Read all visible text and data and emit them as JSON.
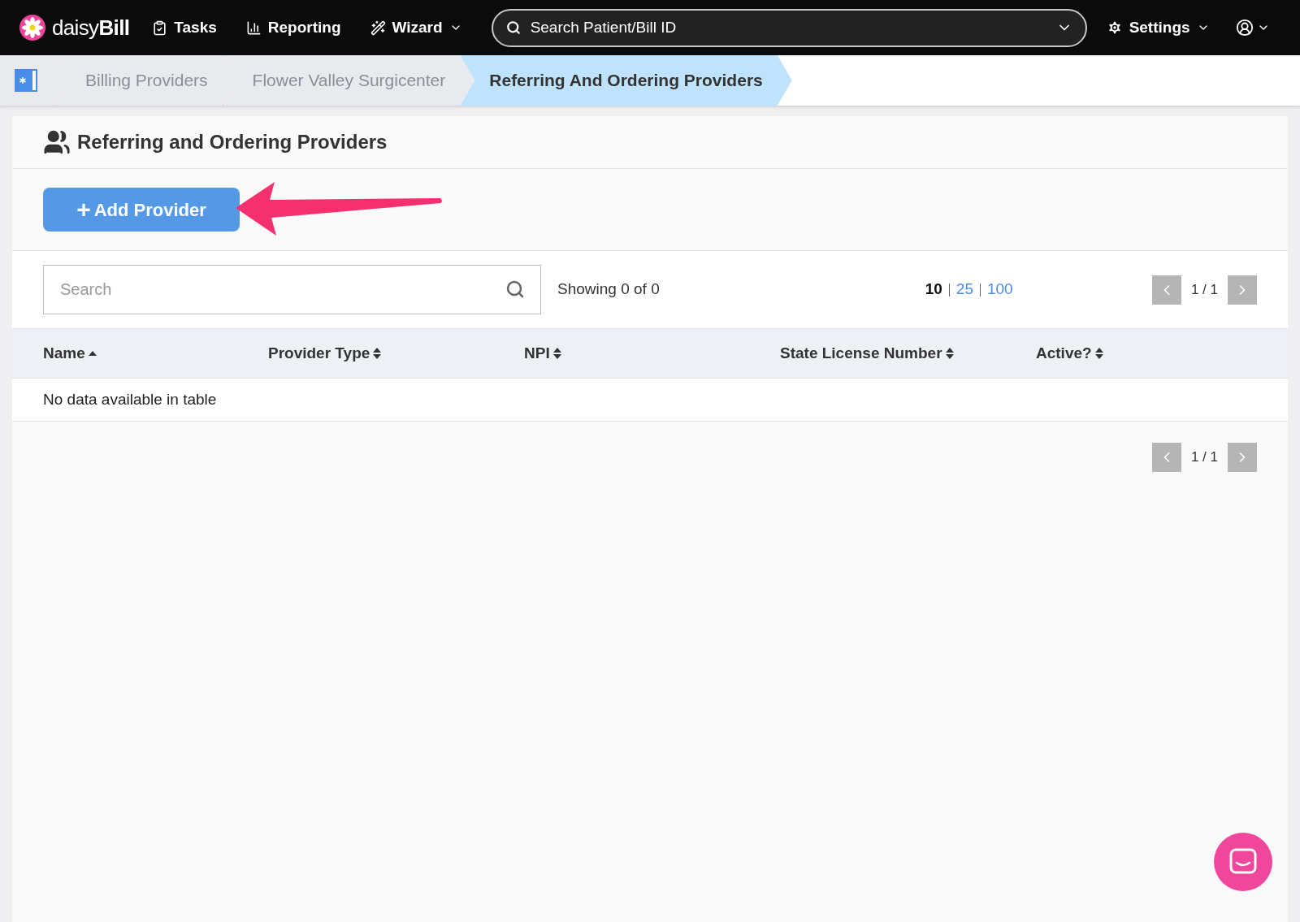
{
  "nav": {
    "brand": {
      "light": "daisy",
      "bold": "Bill"
    },
    "items": [
      {
        "label": "Tasks",
        "dropdown": false
      },
      {
        "label": "Reporting",
        "dropdown": false
      },
      {
        "label": "Wizard",
        "dropdown": true
      }
    ],
    "search": {
      "placeholder": "Search Patient/Bill ID"
    },
    "settings": {
      "label": "Settings"
    }
  },
  "breadcrumbs": [
    {
      "label": "Billing Providers",
      "selected": false
    },
    {
      "label": "Flower Valley Surgicenter",
      "selected": false
    },
    {
      "label": "Referring And Ordering Providers",
      "selected": true
    }
  ],
  "panel": {
    "title": "Referring and Ordering Providers",
    "add_button": {
      "icon": "+",
      "label": "Add Provider"
    },
    "search": {
      "placeholder": "Search"
    },
    "showing": "Showing 0 of 0",
    "page_sizes": [
      {
        "label": "10",
        "selected": true
      },
      {
        "label": "25",
        "selected": false
      },
      {
        "label": "100",
        "selected": false
      }
    ],
    "pager_top": "1 / 1",
    "columns": [
      {
        "label": "Name",
        "sorted": true
      },
      {
        "label": "Provider Type",
        "sorted": false
      },
      {
        "label": "NPI",
        "sorted": false
      },
      {
        "label": "State License Number",
        "sorted": false
      },
      {
        "label": "Active?",
        "sorted": false
      }
    ],
    "empty_message": "No data available in table",
    "pager_bottom": "1 / 1"
  }
}
